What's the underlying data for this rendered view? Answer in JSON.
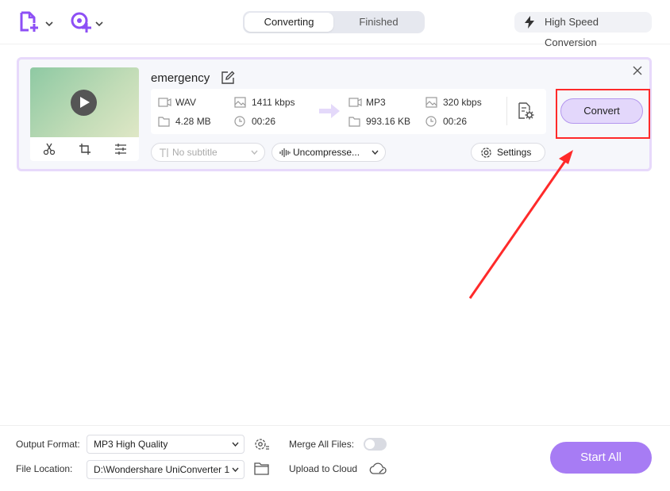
{
  "topbar": {
    "add_file_icon": "add-file-icon",
    "add_media_icon": "add-media-icon",
    "tabs": [
      {
        "label": "Converting",
        "active": true
      },
      {
        "label": "Finished",
        "active": false
      }
    ],
    "high_speed_label": "High Speed Conversion"
  },
  "file": {
    "name": "emergency",
    "source": {
      "format": "WAV",
      "bitrate": "1411 kbps",
      "size": "4.28 MB",
      "duration": "00:26"
    },
    "target": {
      "format": "MP3",
      "bitrate": "320 kbps",
      "size": "993.16 KB",
      "duration": "00:26"
    },
    "subtitle_placeholder": "No subtitle",
    "audio_track": "Uncompresse...",
    "settings_label": "Settings",
    "convert_label": "Convert"
  },
  "bottom": {
    "output_format_label": "Output Format:",
    "output_format_value": "MP3 High Quality",
    "file_location_label": "File Location:",
    "file_location_value": "D:\\Wondershare UniConverter 1",
    "merge_label": "Merge All Files:",
    "merge_enabled": false,
    "upload_label": "Upload to Cloud",
    "start_all_label": "Start All"
  },
  "colors": {
    "accent": "#a77cf4",
    "card_border": "#e7d9fb",
    "highlight": "#ff2a2a"
  }
}
